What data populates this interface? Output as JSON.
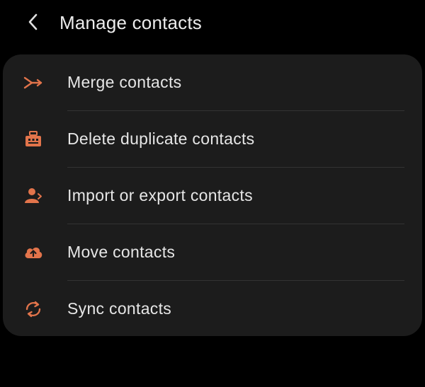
{
  "header": {
    "title": "Manage contacts",
    "back_icon": "chevron-left-icon"
  },
  "theme": {
    "accent": "#e2744b",
    "background": "#000000",
    "card": "#1c1c1c",
    "text": "#e6e6e6",
    "divider": "#333333"
  },
  "menu": {
    "items": [
      {
        "label": "Merge contacts",
        "icon": "merge-icon"
      },
      {
        "label": "Delete duplicate contacts",
        "icon": "delete-duplicates-icon"
      },
      {
        "label": "Import or export contacts",
        "icon": "import-export-icon"
      },
      {
        "label": "Move contacts",
        "icon": "cloud-move-icon"
      },
      {
        "label": "Sync contacts",
        "icon": "sync-icon"
      }
    ]
  }
}
